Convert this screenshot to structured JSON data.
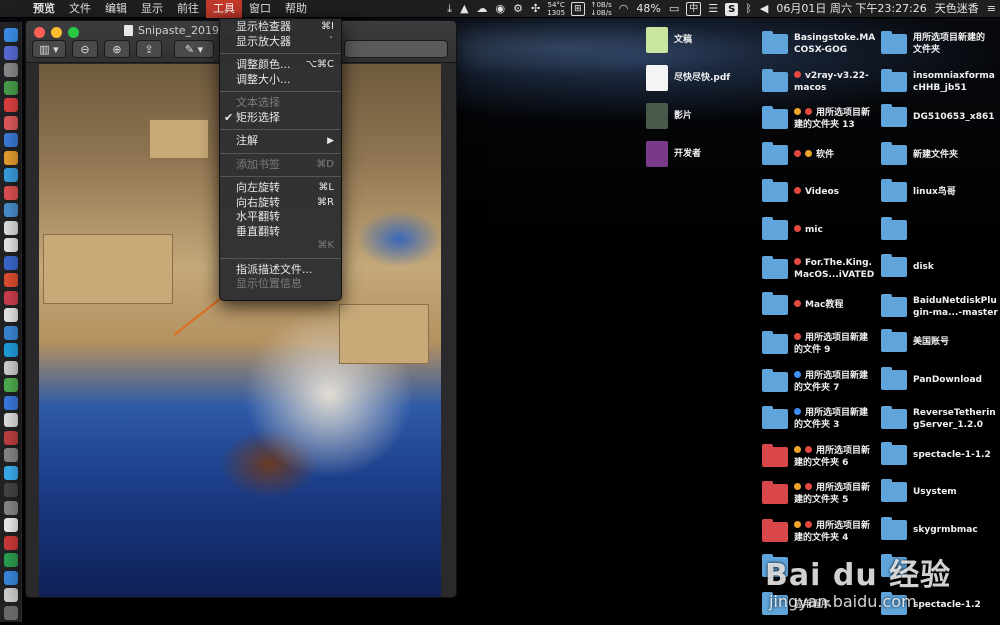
{
  "menubar": {
    "app": "预览",
    "items": [
      "文件",
      "编辑",
      "显示",
      "前往",
      "工具",
      "窗口",
      "帮助"
    ],
    "active_item": "工具",
    "status": {
      "temp": "54°C",
      "fan": "1305",
      "net_up": "↑0B/s",
      "net_down": "↓0B/s",
      "datetime": "06月01日 周六 下午23:27:26",
      "battery": "48%",
      "input_method": "中",
      "user": "天色迷香"
    }
  },
  "window": {
    "title": "Snipaste_2019-06-"
  },
  "dropdown": {
    "items": [
      {
        "label": "显示检查器",
        "shortcut": "⌘I",
        "disabled": false
      },
      {
        "label": "显示放大器",
        "shortcut": "`",
        "disabled": false
      },
      {
        "sep": true
      },
      {
        "label": "调整颜色...",
        "shortcut": "⌥⌘C",
        "disabled": false
      },
      {
        "label": "调整大小...",
        "shortcut": "",
        "disabled": false
      },
      {
        "sep": true
      },
      {
        "label": "文本选择",
        "shortcut": "",
        "disabled": true
      },
      {
        "label": "矩形选择",
        "shortcut": "",
        "disabled": false,
        "checked": true
      },
      {
        "sep": true
      },
      {
        "label": "注解",
        "shortcut": "",
        "disabled": false,
        "submenu": true
      },
      {
        "sep": true
      },
      {
        "label": "添加书签",
        "shortcut": "⌘D",
        "disabled": true
      },
      {
        "sep": true
      },
      {
        "label": "向左旋转",
        "shortcut": "⌘L",
        "disabled": false
      },
      {
        "label": "向右旋转",
        "shortcut": "⌘R",
        "disabled": false
      },
      {
        "label": "水平翻转",
        "shortcut": "",
        "disabled": false
      },
      {
        "label": "垂直翻转",
        "shortcut": "",
        "disabled": false
      },
      {
        "label": "",
        "shortcut": "⌘K",
        "disabled": true
      },
      {
        "sep": true
      },
      {
        "label": "指派描述文件...",
        "shortcut": "",
        "disabled": false
      },
      {
        "label": "显示位置信息",
        "shortcut": "",
        "disabled": true
      }
    ]
  },
  "desktop": {
    "col1": [
      {
        "label": "文稿",
        "kind": "thumb",
        "color": "#c8e6a0"
      },
      {
        "label": "尽快尽快.pdf",
        "kind": "thumb",
        "color": "#f4f4f4"
      },
      {
        "label": "影片",
        "kind": "thumb",
        "color": "#4a5a4a"
      },
      {
        "label": "开发者",
        "kind": "thumb",
        "color": "#7a3a8a"
      }
    ],
    "col2": [
      {
        "label": "Basingstoke.MA",
        "label2": "COSX-GOG",
        "tags": [],
        "red": false
      },
      {
        "label": "v2ray-v3.22-",
        "label2": "macos",
        "tags": [
          "red"
        ],
        "red": false
      },
      {
        "label": "用所选项目新",
        "label2": "建的文件夹 13",
        "tags": [
          "orange",
          "red"
        ],
        "red": false
      },
      {
        "label": "软件",
        "label2": "",
        "tags": [
          "red",
          "orange"
        ],
        "red": false
      },
      {
        "label": "Videos",
        "label2": "",
        "tags": [
          "red"
        ],
        "red": false
      },
      {
        "label": "mic",
        "label2": "",
        "tags": [
          "red"
        ],
        "red": false
      },
      {
        "label": "For.The.King.",
        "label2": "MacOS...iVATED",
        "tags": [
          "red"
        ],
        "red": false
      },
      {
        "label": "Mac教程",
        "label2": "",
        "tags": [
          "red"
        ],
        "red": false
      },
      {
        "label": "用所选项目新建",
        "label2": "的文件 9",
        "tags": [
          "red"
        ],
        "red": false
      },
      {
        "label": "用所选项目新建",
        "label2": "的文件夹 7",
        "tags": [
          "blue"
        ],
        "red": false
      },
      {
        "label": "用所选项目新建",
        "label2": "的文件夹 3",
        "tags": [
          "blue"
        ],
        "red": false
      },
      {
        "label": "用所选项目新",
        "label2": "建的文件夹 6",
        "tags": [
          "orange",
          "red"
        ],
        "red": true
      },
      {
        "label": "用所选项目新",
        "label2": "建的文件夹 5",
        "tags": [
          "orange",
          "red"
        ],
        "red": true
      },
      {
        "label": "用所选项目新",
        "label2": "建的文件夹 4",
        "tags": [
          "orange",
          "red"
        ],
        "red": true
      },
      {
        "label": "",
        "label2": "",
        "tags": [],
        "red": false
      },
      {
        "label": "应用程序",
        "label2": "",
        "tags": [],
        "red": false
      }
    ],
    "col3": [
      {
        "label": "用所选项目新建的",
        "label2": "文件夹"
      },
      {
        "label": "insomniaxforma",
        "label2": "cHHB_jb51"
      },
      {
        "label": "DG510653_x861",
        "label2": ""
      },
      {
        "label": "新建文件夹",
        "label2": ""
      },
      {
        "label": "linux鸟哥",
        "label2": ""
      },
      {
        "label": "",
        "label2": ""
      },
      {
        "label": "disk",
        "label2": ""
      },
      {
        "label": "BaiduNetdiskPlu",
        "label2": "gin-ma...-master"
      },
      {
        "label": "美国账号",
        "label2": ""
      },
      {
        "label": "PanDownload",
        "label2": ""
      },
      {
        "label": "ReverseTetherin",
        "label2": "gServer_1.2.0"
      },
      {
        "label": "spectacle-1-1.2",
        "label2": ""
      },
      {
        "label": "Usystem",
        "label2": ""
      },
      {
        "label": "skygrmbmac",
        "label2": ""
      },
      {
        "label": "",
        "label2": ""
      },
      {
        "label": "spectacle-1.2",
        "label2": ""
      }
    ]
  },
  "watermark": {
    "brand": "Bai du 经验",
    "url": "jingyan.baidu.com"
  },
  "colors": {
    "menu_active": "#c33a2c",
    "folder_blue": "#5fa5db",
    "folder_red": "#d9474a"
  }
}
